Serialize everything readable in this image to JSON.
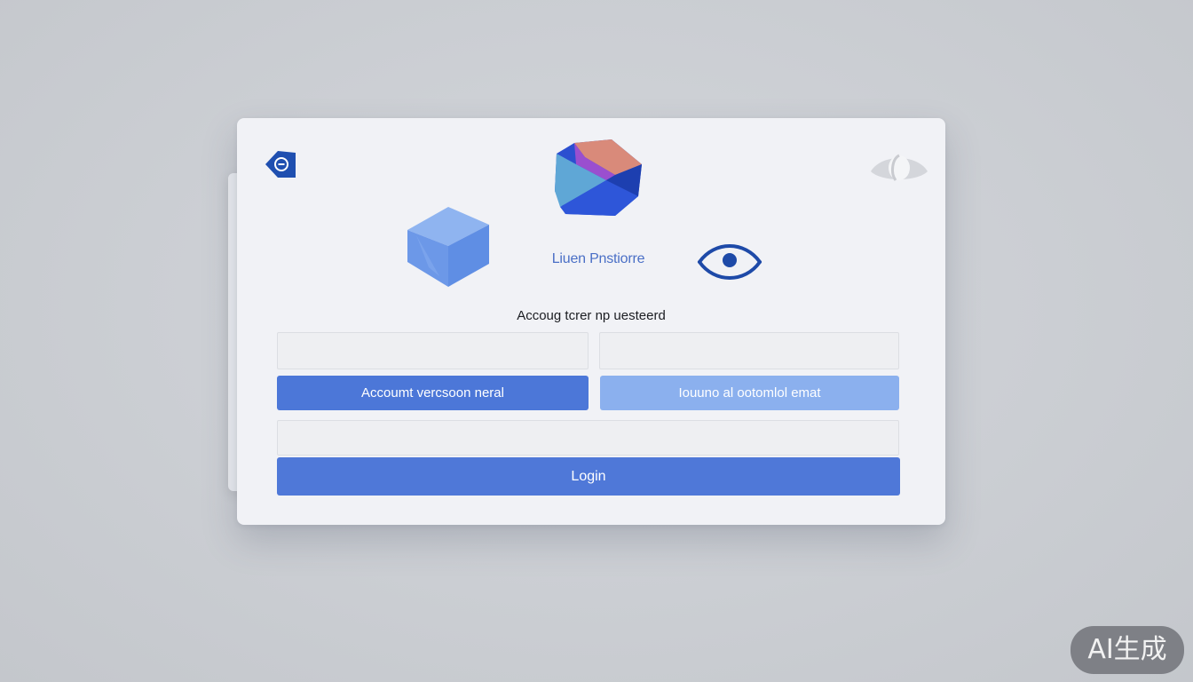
{
  "brand": {
    "name": "Liuen Pnstiorre",
    "accent_color": "#4c77d8",
    "light_accent_color": "#8bb0ee"
  },
  "icons": {
    "corner_logo": "tag-logo-icon",
    "top_gem": "gem-logo-icon",
    "top_right": "eye-outline-icon",
    "cube": "cube-icon",
    "eye": "eye-icon"
  },
  "form": {
    "subtitle": "Accoug tcrer np uesteerd",
    "field_left": {
      "value": "",
      "placeholder": ""
    },
    "field_right": {
      "value": "",
      "placeholder": ""
    },
    "field_wide": {
      "value": "",
      "placeholder": ""
    },
    "button_left_label": "Accoumt vercsoon neral",
    "button_right_label": "Iouuno al ootomlol emat",
    "login_label": "Login"
  },
  "watermark": {
    "label": "AI生成"
  }
}
